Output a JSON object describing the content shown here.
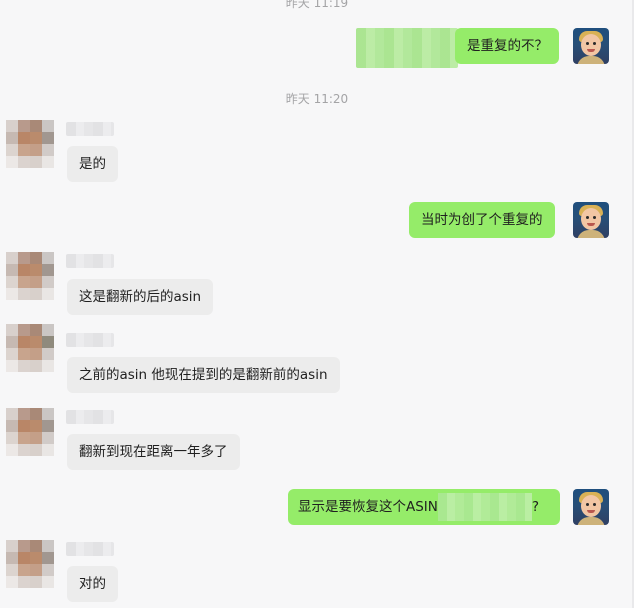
{
  "timestamps": [
    "昨天 11:19",
    "昨天 11:20"
  ],
  "messages": [
    {
      "side": "right",
      "text": "是重复的不？"
    },
    {
      "side": "left",
      "text": "是的"
    },
    {
      "side": "right",
      "text": "当时为创了个重复的"
    },
    {
      "side": "left",
      "text": "这是翻新的后的asin"
    },
    {
      "side": "left",
      "text": "之前的asin 他现在提到的是翻新前的asin"
    },
    {
      "side": "left",
      "text": "翻新到现在距离一年多了"
    },
    {
      "side": "right",
      "text_before": "显示是要恢复这个ASIN",
      "text_after": "?"
    },
    {
      "side": "left",
      "text": "对的"
    }
  ],
  "colors": {
    "my_bubble": "#95ec69",
    "their_bubble": "#ececec",
    "background": "#f7f7f8",
    "timestamp": "#a4a4a6"
  },
  "icons": {
    "my_avatar": "avatar-me-icon",
    "contact_avatar": "avatar-contact-icon"
  }
}
